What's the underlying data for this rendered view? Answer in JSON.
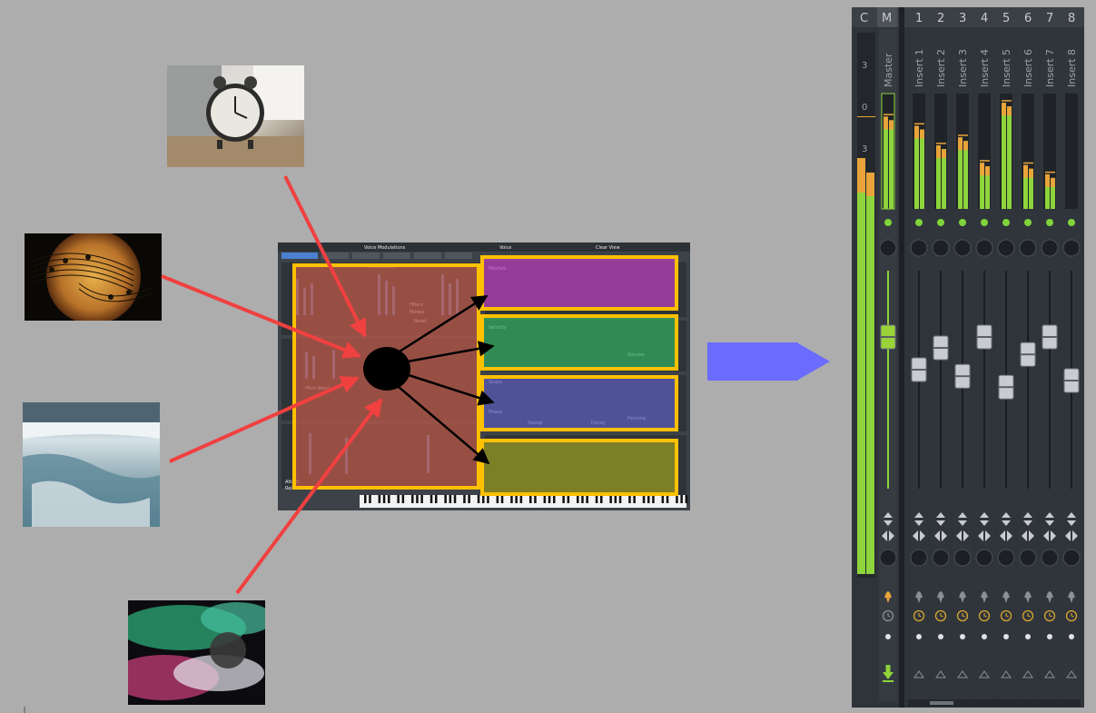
{
  "synth": {
    "header_left": "Voice Modulations",
    "header_mid": "Voice",
    "header_right": "Clear View",
    "labels": [
      "Parameters",
      "Reset",
      "Filters",
      "Modes",
      "Patches",
      "Velocity",
      "Scope",
      "Phase",
      "Sweep",
      "Decay",
      "Attack",
      "Release",
      "Pitch Bend",
      "Panning",
      "Volume"
    ]
  },
  "mixer": {
    "header_c": "C",
    "header_m": "M",
    "master_name": "Master",
    "channel_numbers": [
      "1",
      "2",
      "3",
      "4",
      "5",
      "6",
      "7",
      "8"
    ],
    "insert_names": [
      "Insert 1",
      "Insert 2",
      "Insert 3",
      "Insert 4",
      "Insert 5",
      "Insert 6",
      "Insert 7",
      "Insert 8"
    ],
    "scale_top": "3",
    "scale_zero": "0",
    "scale_bottom": "3",
    "meter_levels": [
      0.72,
      0.55,
      0.62,
      0.4,
      0.92,
      0.38,
      0.3
    ],
    "fader_levels": [
      0.7,
      0.55,
      0.65,
      0.52,
      0.7,
      0.47,
      0.62,
      0.7
    ]
  },
  "colors": {
    "background": "#adadad",
    "arrow_red": "#f04040",
    "arrow_black": "#000000",
    "arrow_blue": "#6b6bff",
    "highlight_red": "#c06050",
    "highlight_yellow": "#ffc000",
    "highlight_magenta": "#c040c0",
    "highlight_green": "#30b060",
    "highlight_purple": "#6060b0",
    "highlight_olive": "#a0a020",
    "meter_green": "#8ed43c",
    "meter_orange": "#e8a43a"
  },
  "icons": {
    "photo1": "alarm-clock-photo",
    "photo2": "music-notes-photo",
    "photo3": "waterfall-photo",
    "photo4": "colorful-smoke-photo",
    "center": "black-circle-hub",
    "big_arrow": "blue-arrow-icon"
  }
}
